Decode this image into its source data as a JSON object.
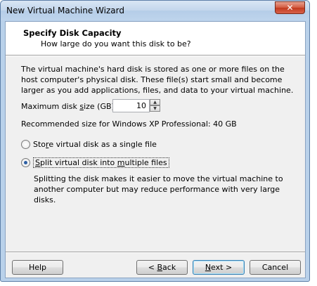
{
  "window": {
    "title": "New Virtual Machine Wizard",
    "close_glyph": "✕"
  },
  "header": {
    "title": "Specify Disk Capacity",
    "subtitle": "How large do you want this disk to be?"
  },
  "body": {
    "description": "The virtual machine's hard disk is stored as one or more files on the host computer's physical disk. These file(s) start small and become larger as you add applications, files, and data to your virtual machine.",
    "max_size_label": "Maximum disk size (GB):",
    "max_size_value": "10",
    "recommended": "Recommended size for Windows XP Professional: 40 GB",
    "options": [
      {
        "label": "Store virtual disk as a single file",
        "checked": false
      },
      {
        "label": "Split virtual disk into multiple files",
        "checked": true
      }
    ],
    "split_help": "Splitting the disk makes it easier to move the virtual machine to another computer but may reduce performance with very large disks."
  },
  "buttons": {
    "help": "Help",
    "back": "< Back",
    "next": "Next >",
    "cancel": "Cancel"
  }
}
